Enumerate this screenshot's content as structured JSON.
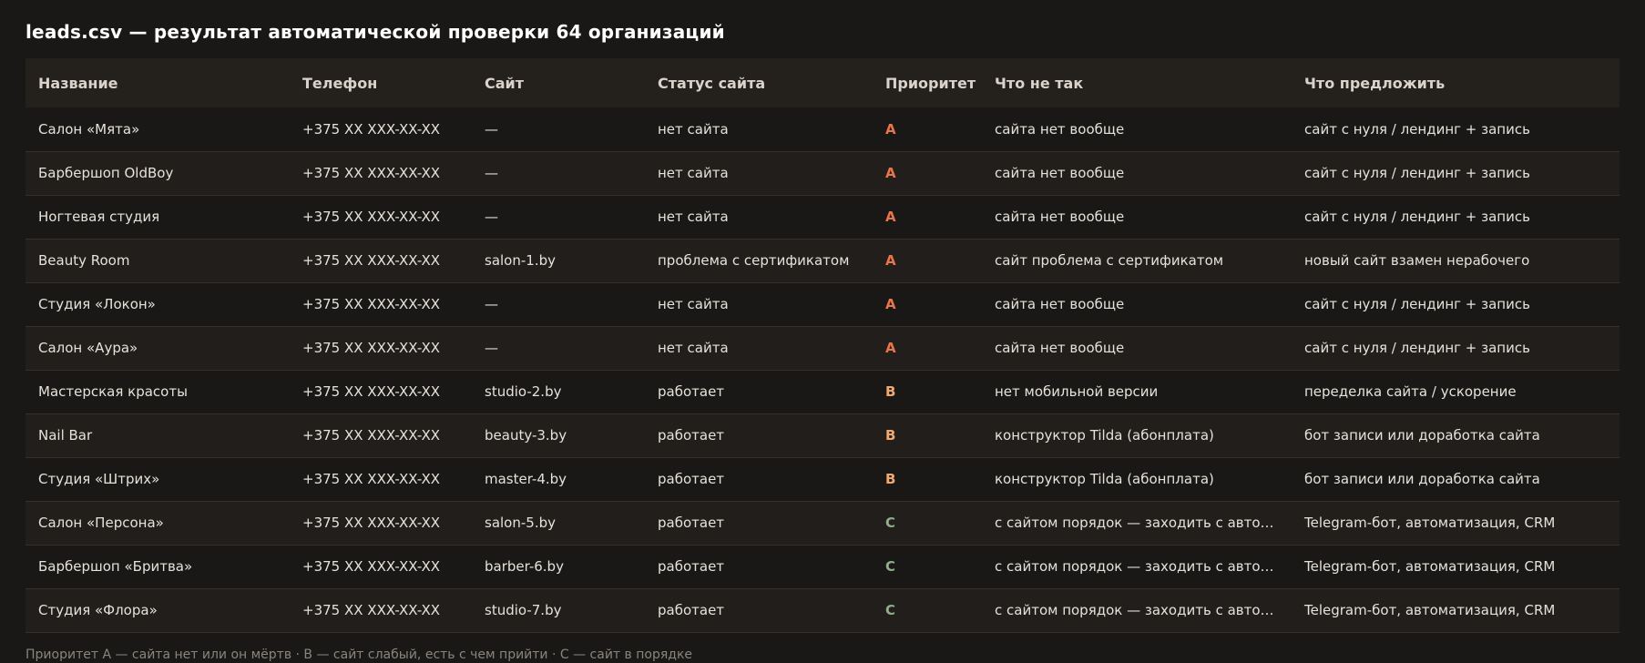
{
  "title": "leads.csv — результат автоматической проверки 64 организаций",
  "columns": [
    "Название",
    "Телефон",
    "Сайт",
    "Статус сайта",
    "Приоритет",
    "Что не так",
    "Что предложить"
  ],
  "rows": [
    {
      "name": "Салон «Мята»",
      "phone": "+375 XX XXX-XX-XX",
      "site": "—",
      "status": "нет сайта",
      "priority": "A",
      "problem": "сайта нет вообще",
      "offer": "сайт с нуля / лендинг + запись"
    },
    {
      "name": "Барбершоп OldBoy",
      "phone": "+375 XX XXX-XX-XX",
      "site": "—",
      "status": "нет сайта",
      "priority": "A",
      "problem": "сайта нет вообще",
      "offer": "сайт с нуля / лендинг + запись"
    },
    {
      "name": "Ногтевая студия",
      "phone": "+375 XX XXX-XX-XX",
      "site": "—",
      "status": "нет сайта",
      "priority": "A",
      "problem": "сайта нет вообще",
      "offer": "сайт с нуля / лендинг + запись"
    },
    {
      "name": "Beauty Room",
      "phone": "+375 XX XXX-XX-XX",
      "site": "salon-1.by",
      "status": "проблема с сертификатом",
      "priority": "A",
      "problem": "сайт проблема с сертификатом",
      "offer": "новый сайт взамен нерабочего"
    },
    {
      "name": "Студия «Локон»",
      "phone": "+375 XX XXX-XX-XX",
      "site": "—",
      "status": "нет сайта",
      "priority": "A",
      "problem": "сайта нет вообще",
      "offer": "сайт с нуля / лендинг + запись"
    },
    {
      "name": "Салон «Аура»",
      "phone": "+375 XX XXX-XX-XX",
      "site": "—",
      "status": "нет сайта",
      "priority": "A",
      "problem": "сайта нет вообще",
      "offer": "сайт с нуля / лендинг + запись"
    },
    {
      "name": "Мастерская красоты",
      "phone": "+375 XX XXX-XX-XX",
      "site": "studio-2.by",
      "status": "работает",
      "priority": "B",
      "problem": "нет мобильной версии",
      "offer": "переделка сайта / ускорение"
    },
    {
      "name": "Nail Bar",
      "phone": "+375 XX XXX-XX-XX",
      "site": "beauty-3.by",
      "status": "работает",
      "priority": "B",
      "problem": "конструктор Tilda (абонплата)",
      "offer": "бот записи или доработка сайта"
    },
    {
      "name": "Студия «Штрих»",
      "phone": "+375 XX XXX-XX-XX",
      "site": "master-4.by",
      "status": "работает",
      "priority": "B",
      "problem": "конструктор Tilda (абонплата)",
      "offer": "бот записи или доработка сайта"
    },
    {
      "name": "Салон «Персона»",
      "phone": "+375 XX XXX-XX-XX",
      "site": "salon-5.by",
      "status": "работает",
      "priority": "C",
      "problem": "с сайтом порядок — заходить с авто…",
      "offer": "Telegram-бот, автоматизация, CRM"
    },
    {
      "name": "Барбершоп «Бритва»",
      "phone": "+375 XX XXX-XX-XX",
      "site": "barber-6.by",
      "status": "работает",
      "priority": "C",
      "problem": "с сайтом порядок — заходить с авто…",
      "offer": "Telegram-бот, автоматизация, CRM"
    },
    {
      "name": "Студия «Флора»",
      "phone": "+375 XX XXX-XX-XX",
      "site": "studio-7.by",
      "status": "работает",
      "priority": "C",
      "problem": "с сайтом порядок — заходить с авто…",
      "offer": "Telegram-бот, автоматизация, CRM"
    }
  ],
  "priority_colors": {
    "A": "#e8764a",
    "B": "#f0a870",
    "C": "#8fae8c"
  },
  "footnote": "Приоритет A — сайта нет или он мёртв · B — сайт слабый, есть с чем прийти · C — сайт в порядке"
}
